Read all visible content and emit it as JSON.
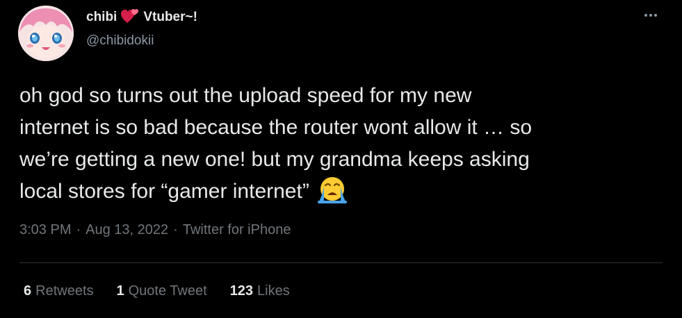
{
  "tweet": {
    "display_name_part1": "chibi",
    "display_name_part2": "Vtuber~!",
    "heart_icon": "two-hearts-emoji",
    "handle": "@chibidokii",
    "text": "oh god so turns out the upload speed for my new\ninternet is so bad because the router wont allow it … so\nwe’re getting a new one! but my grandma keeps asking\nlocal stores for “gamer internet”",
    "text_emoji": "loudly-crying-face-emoji",
    "time": "3:03 PM",
    "date": "Aug 13, 2022",
    "separator": "·",
    "source": "Twitter for iPhone"
  },
  "stats": {
    "retweets_count": "6",
    "retweets_label": "Retweets",
    "quotes_count": "1",
    "quotes_label": "Quote Tweet",
    "likes_count": "123",
    "likes_label": "Likes"
  },
  "colors": {
    "background": "#000000",
    "primary_text": "#e7e9ea",
    "secondary_text": "#71767b",
    "divider": "#2f3336"
  }
}
